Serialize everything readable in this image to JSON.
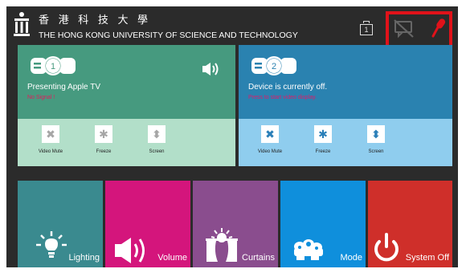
{
  "header": {
    "university_zh": "香 港 科 技 大 學",
    "university_en": "THE HONG KONG UNIVERSITY OF SCIENCE AND TECHNOLOGY",
    "display_number": "1"
  },
  "panels": [
    {
      "number": "1",
      "title": "Presenting Apple TV",
      "status": "No Signal !",
      "controls": [
        "Video Mute",
        "Freeze",
        "Screen"
      ],
      "colors": {
        "upper": "#469a7f",
        "lower": "#b2dfc9"
      }
    },
    {
      "number": "2",
      "title": "Device is currently off.",
      "status": "Press to start video display.",
      "controls": [
        "Video Mute",
        "Freeze",
        "Screen"
      ],
      "colors": {
        "upper": "#2a82b0",
        "lower": "#8fcdee"
      }
    }
  ],
  "tiles": [
    {
      "label": "Lighting",
      "icon": "lightbulb-icon",
      "color": "#3a8a8f"
    },
    {
      "label": "Volume",
      "icon": "speaker-icon",
      "color": "#d4157c"
    },
    {
      "label": "Curtains",
      "icon": "curtains-icon",
      "color": "#8a4d8e"
    },
    {
      "label": "Mode",
      "icon": "mode-icon",
      "color": "#0f8fdc"
    },
    {
      "label": "System Off",
      "icon": "power-icon",
      "color": "#cf2f2a"
    }
  ],
  "highlight_color": "#e0121a"
}
